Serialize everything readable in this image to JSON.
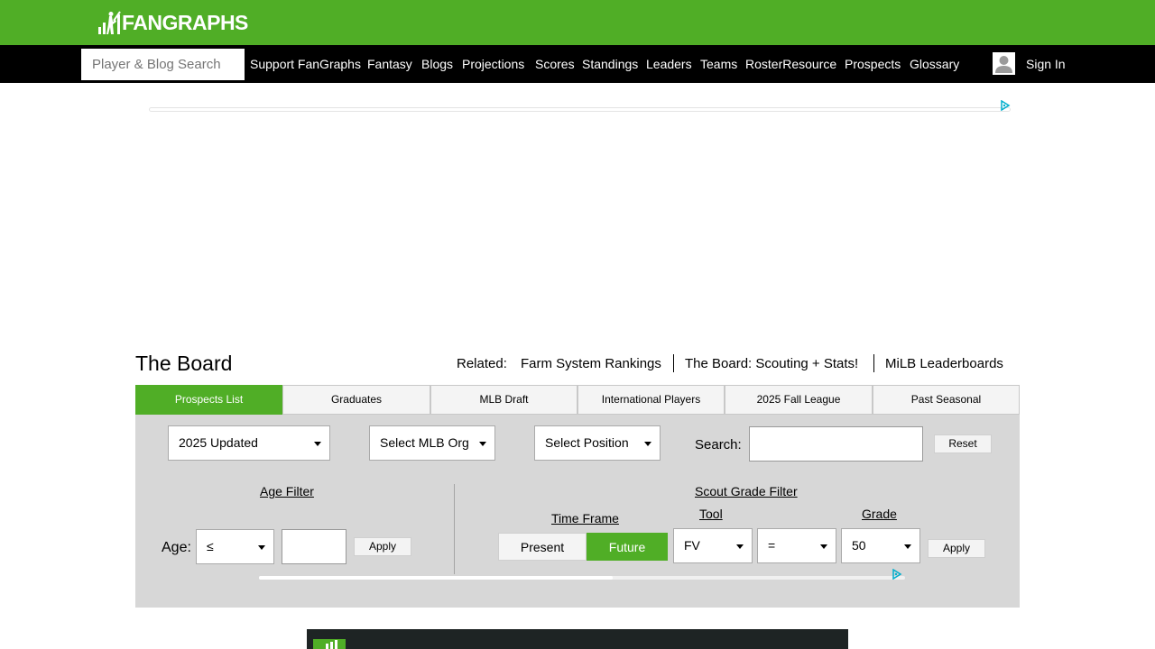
{
  "brand": {
    "name": "FANGRAPHS",
    "green": "#50ae26"
  },
  "nav": {
    "search_placeholder": "Player & Blog Search",
    "items": [
      "Support FanGraphs",
      "Fantasy",
      "Blogs",
      "Projections",
      "Scores",
      "Standings",
      "Leaders",
      "Teams",
      "RosterResource",
      "Prospects",
      "Glossary"
    ],
    "sign_in": "Sign In"
  },
  "board": {
    "title": "The Board",
    "related_label": "Related:",
    "related_links": [
      "Farm System Rankings",
      "The Board: Scouting + Stats!",
      "MiLB Leaderboards"
    ]
  },
  "tabs": [
    {
      "label": "Prospects List",
      "active": true
    },
    {
      "label": "Graduates",
      "active": false
    },
    {
      "label": "MLB Draft",
      "active": false
    },
    {
      "label": "International Players",
      "active": false
    },
    {
      "label": "2025 Fall League",
      "active": false
    },
    {
      "label": "Past Seasonal",
      "active": false
    }
  ],
  "filters": {
    "list_select": "2025 Updated",
    "org_select": "Select MLB Org",
    "position_select": "Select Position",
    "search_label": "Search:",
    "search_value": "",
    "reset_label": "Reset",
    "age_filter_title": "Age Filter",
    "age_label": "Age:",
    "age_operator": "≤",
    "age_value": "",
    "age_apply": "Apply",
    "scout_filter_title": "Scout Grade Filter",
    "time_frame_label": "Time Frame",
    "time_frame_options": [
      "Present",
      "Future"
    ],
    "time_frame_selected": "Future",
    "tool_label": "Tool",
    "tool_value": "FV",
    "operator_value": "=",
    "grade_label": "Grade",
    "grade_value": "50",
    "grade_apply": "Apply"
  }
}
